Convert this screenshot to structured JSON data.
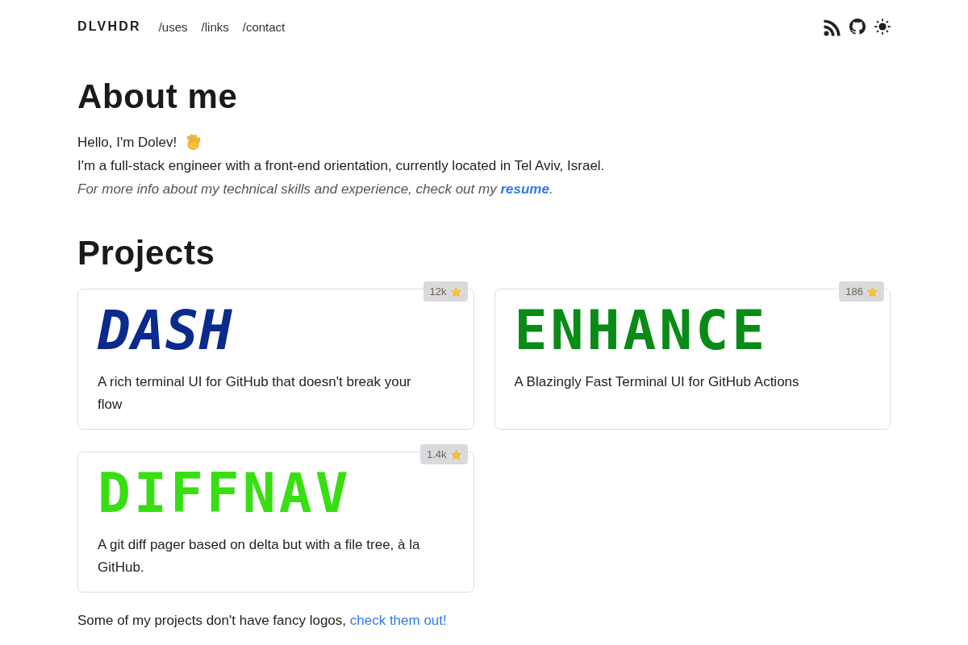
{
  "header": {
    "brand": "DLVHDR",
    "nav": [
      "/uses",
      "/links",
      "/contact"
    ]
  },
  "about": {
    "heading": "About me",
    "greeting": "Hello, I'm Dolev!",
    "bio": "I'm a full-stack engineer with a front-end orientation, currently located in Tel Aviv, Israel.",
    "note": {
      "text": "For more info about my technical skills and experience, check out my",
      "link": "resume",
      "after": "."
    }
  },
  "projects": {
    "heading": "Projects",
    "items": [
      {
        "logo": "DASH",
        "slanted": true,
        "color": "#0a2a8c",
        "star_count": "12k",
        "description": "A rich terminal UI for GitHub that doesn't break your flow"
      },
      {
        "logo": "ENHANCE",
        "slanted": false,
        "color": "#0a8a16",
        "star_count": "186",
        "description": "A Blazingly Fast Terminal UI for GitHub Actions"
      },
      {
        "logo": "DIFFNAV",
        "slanted": false,
        "color": "#38de12",
        "star_count": "1.4k",
        "description": "A git diff pager based on delta but with a file tree, à la GitHub."
      }
    ]
  },
  "footer_note": {
    "text": "Some of my projects don't have fancy logos,",
    "link": "check them out!"
  }
}
